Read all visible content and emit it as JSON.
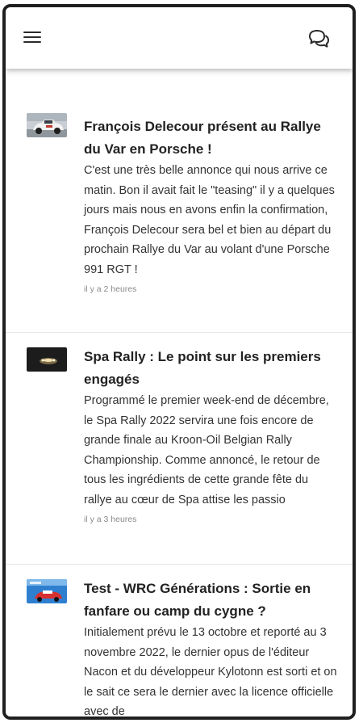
{
  "header": {
    "menu_icon": "hamburger-menu-icon",
    "chat_icon": "chat-bubbles-icon"
  },
  "articles": [
    {
      "title": "François Delecour présent au Rallye du Var en Porsche !",
      "excerpt": "C'est une très belle annonce qui nous arrive ce matin. Bon il avait fait le \"teasing\" il y a quelques jours mais nous en avons enfin la confirmation, François Delecour sera bel et bien au départ du prochain Rallye du Var au volant d'une Porsche 991 RGT !",
      "time": "il y a 2 heures"
    },
    {
      "title": "Spa Rally : Le point sur les premiers engagés",
      "excerpt": "Programmé le premier week-end de décembre, le Spa Rally 2022 servira une fois encore de grande finale au Kroon-Oil Belgian Rally Championship. Comme annoncé, le retour de tous les ingrédients de cette grande fête du rallye au cœur de Spa attise les passio",
      "time": "il y a 3 heures"
    },
    {
      "title": "Test - WRC Générations : Sortie en fanfare ou camp du cygne ?",
      "excerpt": "Initialement prévu le 13 octobre et reporté au 3 novembre 2022, le dernier opus de l'éditeur Nacon et du développeur Kylotonn est sorti et on le sait ce sera le dernier avec la licence officielle avec de",
      "time": ""
    }
  ]
}
